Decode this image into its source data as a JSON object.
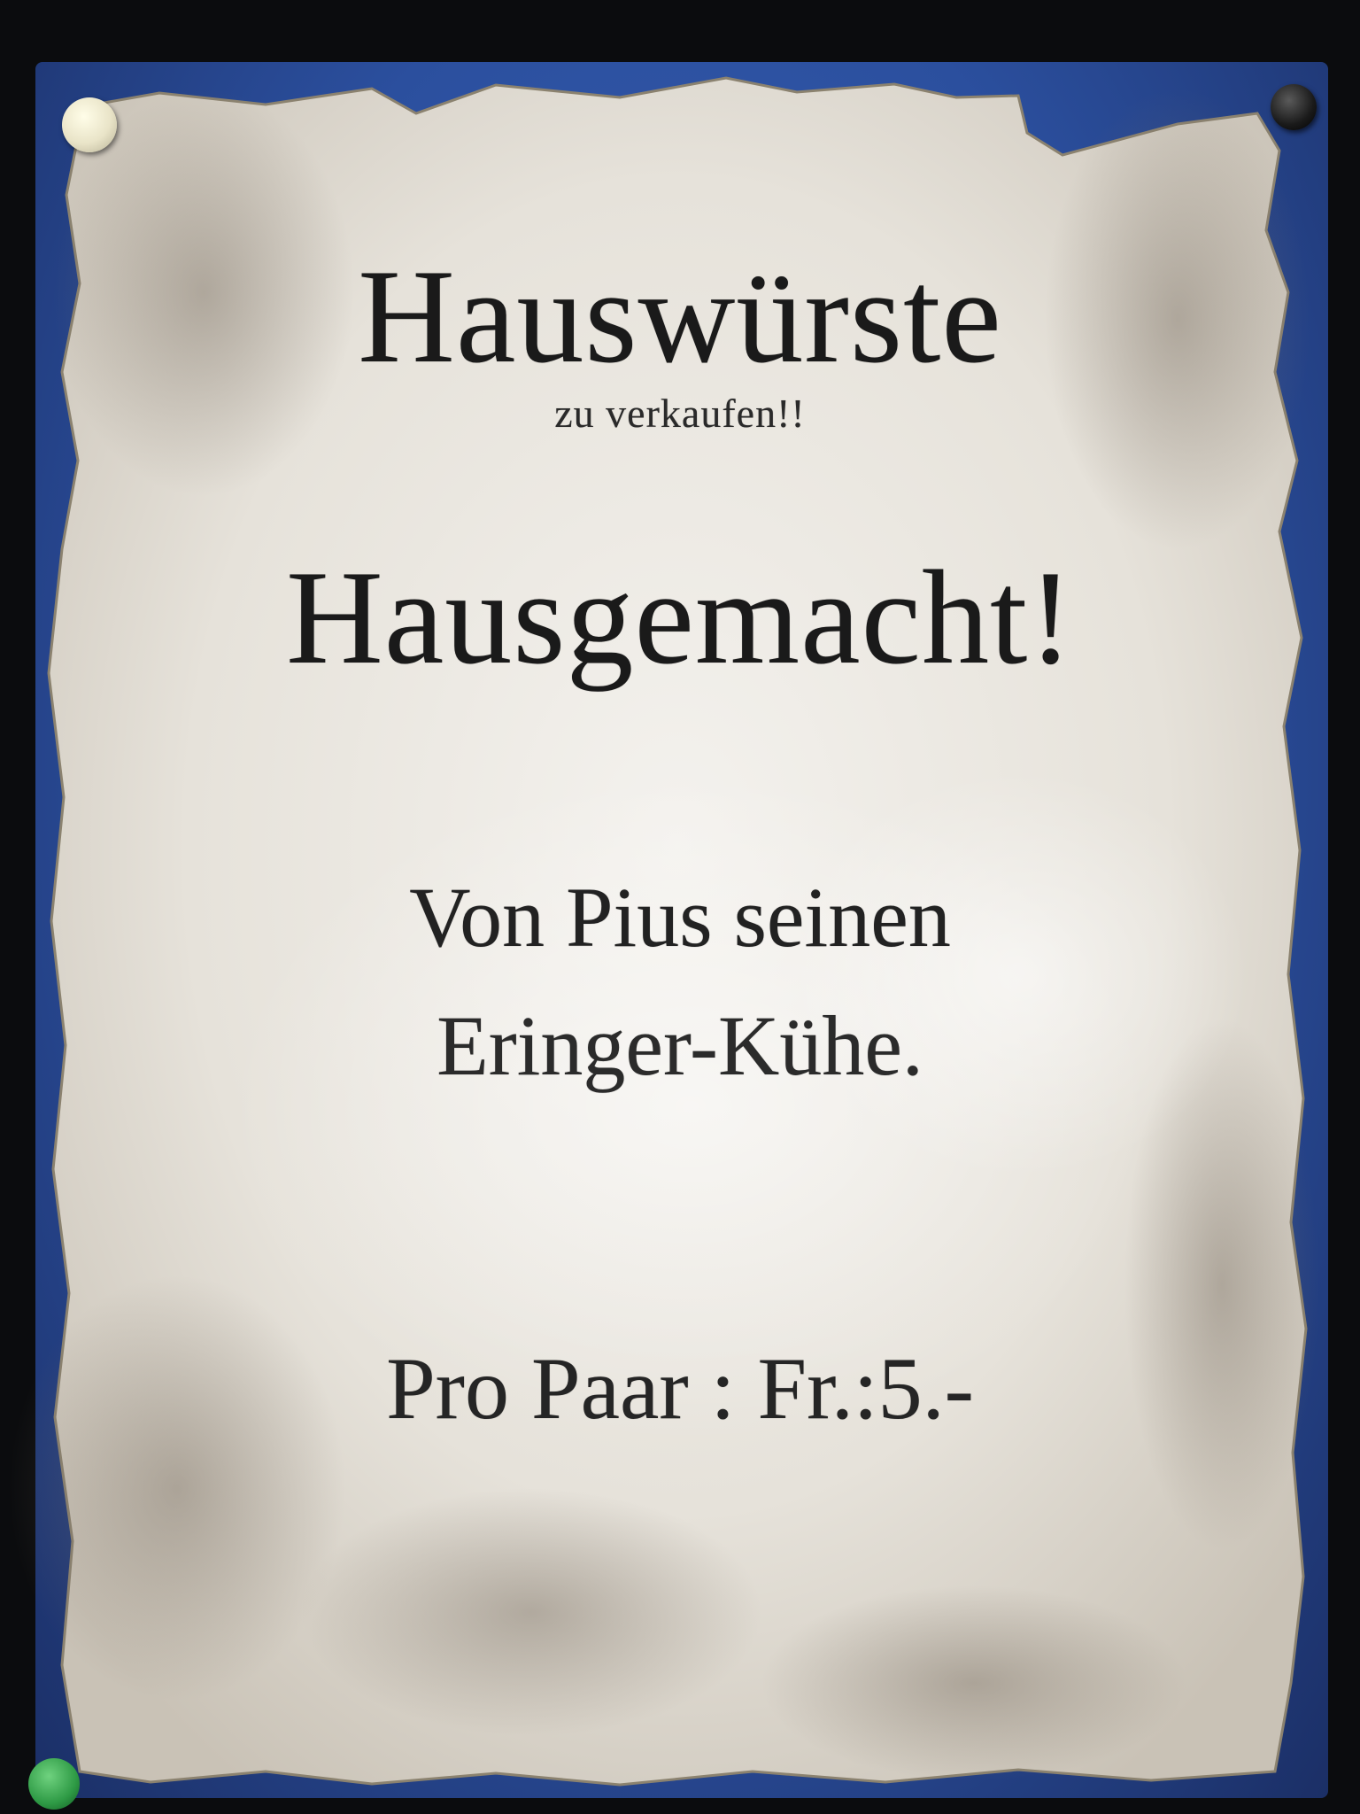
{
  "poster": {
    "title": "Hauswürste",
    "subtitle": "zu verkaufen!!",
    "headline": "Hausgemacht!",
    "origin_line1": "Von Pius seinen",
    "origin_line2": "Eringer-Kühe.",
    "price": "Pro Paar : Fr.:5.-"
  },
  "colors": {
    "board": "#2b4f9e",
    "paper": "#e9e6e0",
    "ink": "#1a1a1a",
    "background": "#0b0c0e"
  }
}
